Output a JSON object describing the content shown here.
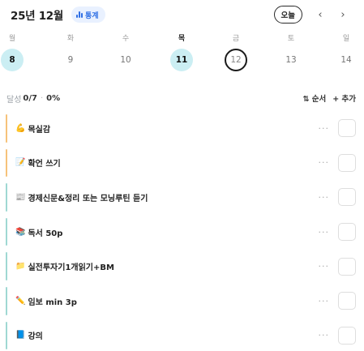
{
  "header": {
    "month_label": "25년 12월",
    "stats_label": "통계",
    "today_label": "오늘",
    "prev_arrow": "‹",
    "next_arrow": "›"
  },
  "calendar": {
    "weekdays": [
      {
        "label": "월",
        "bold": false
      },
      {
        "label": "화",
        "bold": false
      },
      {
        "label": "수",
        "bold": false
      },
      {
        "label": "목",
        "bold": true
      },
      {
        "label": "금",
        "bold": false
      },
      {
        "label": "토",
        "bold": false
      },
      {
        "label": "일",
        "bold": false
      }
    ],
    "dates": [
      {
        "day": "8",
        "state": "done"
      },
      {
        "day": "9",
        "state": "none"
      },
      {
        "day": "10",
        "state": "none"
      },
      {
        "day": "11",
        "state": "done"
      },
      {
        "day": "12",
        "state": "selected"
      },
      {
        "day": "13",
        "state": "none"
      },
      {
        "day": "14",
        "state": "none"
      }
    ]
  },
  "summary": {
    "label": "달성",
    "count": "0/7",
    "separator": "·",
    "percent": "0%",
    "sort_label": "⇅ 순서",
    "add_label": "+ 추가"
  },
  "colors": {
    "accent": "#2f6fe4",
    "done_circle": "#cbeef3",
    "bar_orange": "#f6c27a",
    "bar_teal": "#9fd8d3"
  },
  "items": [
    {
      "emoji": "💪",
      "title": "목실감",
      "bar": "#f6c27a",
      "more": "···"
    },
    {
      "emoji": "📝",
      "title": "확언 쓰기",
      "bar": "#f6c27a",
      "more": "···"
    },
    {
      "emoji": "📰",
      "title": "경제신문&정리 또는 모닝루틴 듣기",
      "bar": "#9fd8d3",
      "more": "···"
    },
    {
      "emoji": "📚",
      "title": "독서 50p",
      "bar": "#9fd8d3",
      "more": "···"
    },
    {
      "emoji": "📁",
      "title": "실전투자기1개읽기+BM",
      "bar": "#9fd8d3",
      "more": "···"
    },
    {
      "emoji": "✏️",
      "title": "임보 min 3p",
      "bar": "#9fd8d3",
      "more": "···"
    },
    {
      "emoji": "📘",
      "title": "강의",
      "bar": "#9fd8d3",
      "more": "···"
    }
  ]
}
